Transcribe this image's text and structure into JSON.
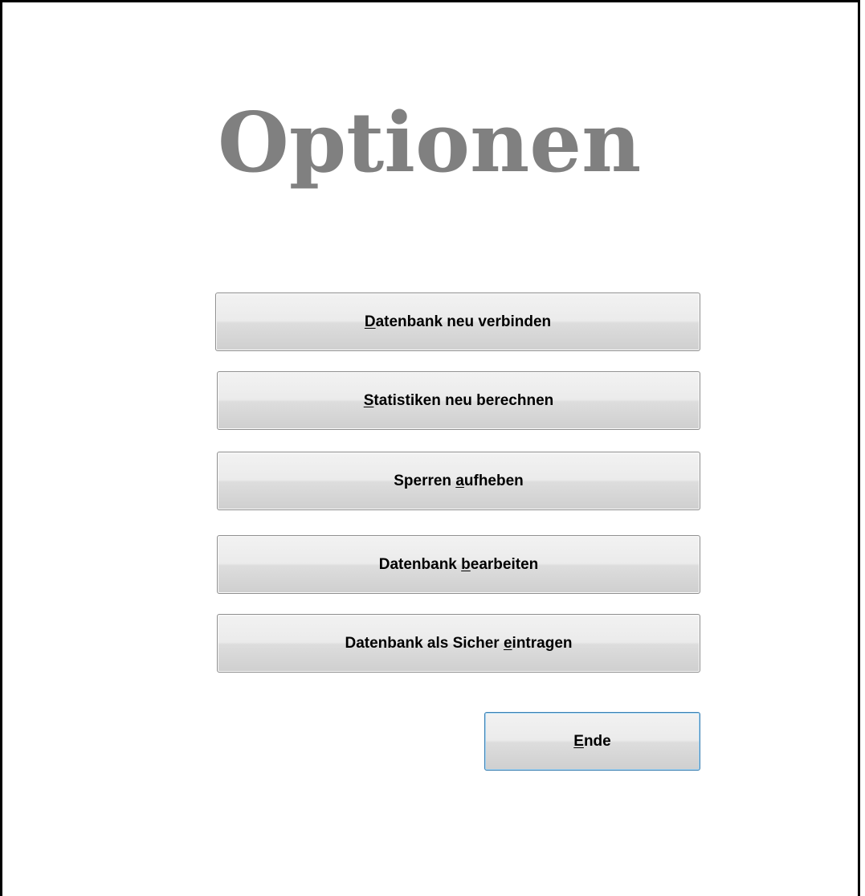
{
  "dialog": {
    "title": "Optionen"
  },
  "buttons": [
    {
      "pre": "",
      "mnemonic": "D",
      "post": "atenbank neu verbinden"
    },
    {
      "pre": "",
      "mnemonic": "S",
      "post": "tatistiken neu berechnen"
    },
    {
      "pre": "Sperren ",
      "mnemonic": "a",
      "post": "ufheben"
    },
    {
      "pre": "Datenbank ",
      "mnemonic": "b",
      "post": "earbeiten"
    },
    {
      "pre": "Datenbank als Sicher ",
      "mnemonic": "e",
      "post": "intragen"
    }
  ],
  "end_button": {
    "pre": "",
    "mnemonic": "E",
    "post": "nde"
  },
  "colors": {
    "title": "#808080",
    "frame": "#000000",
    "default_button_border": "#3c7fb1"
  }
}
